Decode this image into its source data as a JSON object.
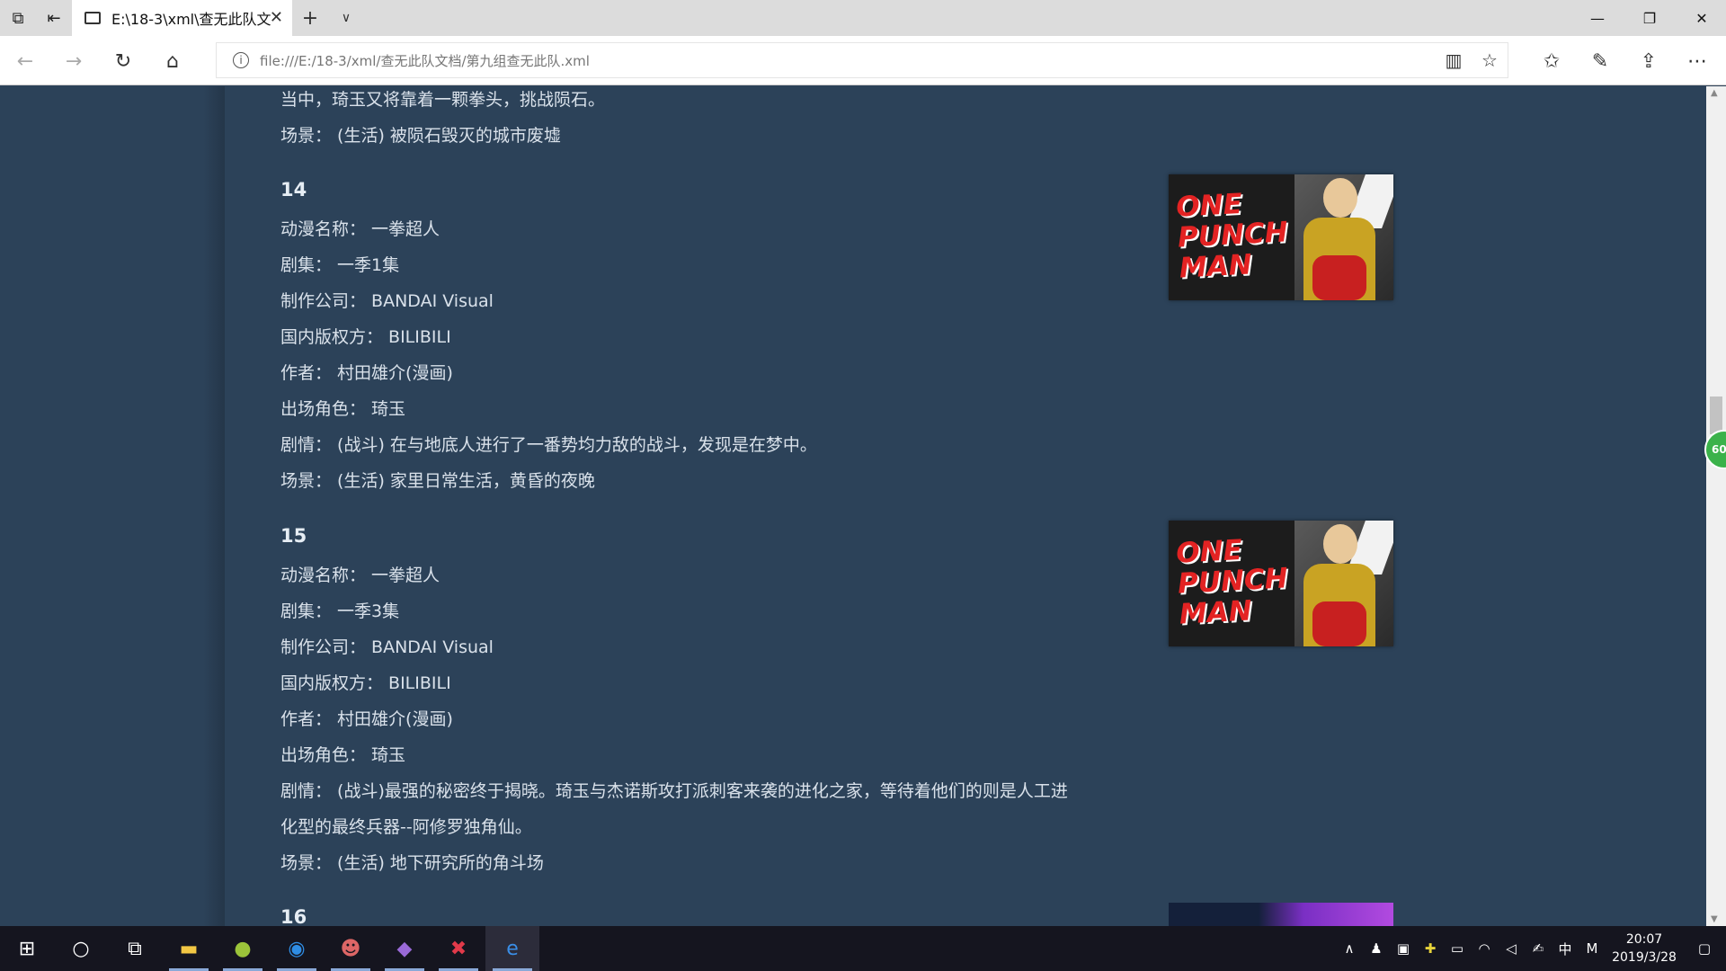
{
  "browser": {
    "tab_title": "E:\\18-3\\xml\\查无此队文",
    "url": "file:///E:/18-3/xml/查无此队文档/第九组查无此队.xml"
  },
  "page": {
    "top_lines": [
      "当中，琦玉又将靠着一颗拳头，挑战陨石。",
      "场景： (生活) 被陨石毁灭的城市废墟"
    ],
    "entries": [
      {
        "number": "14",
        "anime_name": "动漫名称： 一拳超人",
        "episode": "剧集： 一季1集",
        "company": "制作公司： BANDAI Visual",
        "copyright": "国内版权方： BILIBILI",
        "author": "作者： 村田雄介(漫画)",
        "characters": "出场角色： 琦玉",
        "plot": "剧情： (战斗) 在与地底人进行了一番势均力敌的战斗，发现是在梦中。",
        "plot2": "",
        "scene": "场景： (生活) 家里日常生活，黄昏的夜晚",
        "poster_text": "ONE PUNCH MAN"
      },
      {
        "number": "15",
        "anime_name": "动漫名称： 一拳超人",
        "episode": "剧集： 一季3集",
        "company": "制作公司： BANDAI Visual",
        "copyright": "国内版权方： BILIBILI",
        "author": "作者： 村田雄介(漫画)",
        "characters": "出场角色： 琦玉",
        "plot": "剧情： (战斗)最强的秘密终于揭晓。琦玉与杰诺斯攻打派刺客来袭的进化之家，等待着他们的则是人工进",
        "plot2": "化型的最终兵器--阿修罗独角仙。",
        "scene": "场景： (生活) 地下研究所的角斗场",
        "poster_text": "ONE PUNCH MAN"
      }
    ],
    "next_number": "16"
  },
  "badge": "60",
  "taskbar": {
    "time": "20:07",
    "date": "2019/3/28",
    "ime": "中",
    "ime2": "M"
  }
}
